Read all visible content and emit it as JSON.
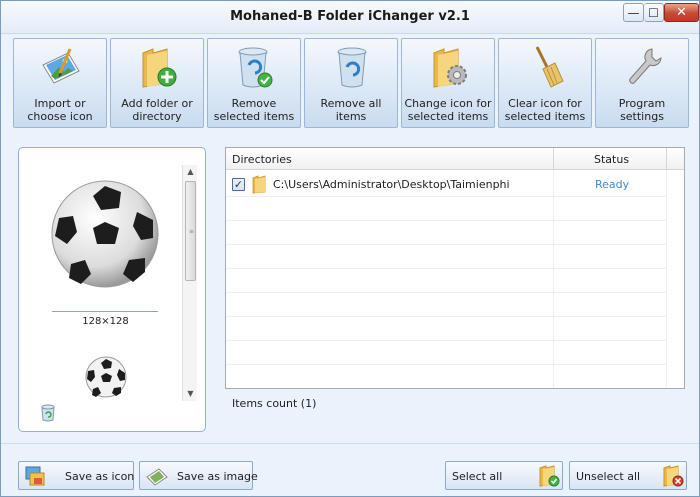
{
  "window": {
    "title": "Mohaned-B Folder iChanger v2.1",
    "minimize_glyph": "—",
    "maximize_glyph": "☐",
    "close_glyph": "✕"
  },
  "toolbar": {
    "buttons": [
      {
        "label": "Import or\nchoose icon",
        "icon": "import-image-icon"
      },
      {
        "label": "Add folder or\ndirectory",
        "icon": "add-folder-icon"
      },
      {
        "label": "Remove\nselected items",
        "icon": "recycle-bin-check-icon"
      },
      {
        "label": "Remove all items",
        "icon": "recycle-bin-icon"
      },
      {
        "label": "Change icon for\nselected items",
        "icon": "folder-gear-icon"
      },
      {
        "label": "Clear icon for\nselected items",
        "icon": "broom-icon"
      },
      {
        "label": "Program\nsettings",
        "icon": "wrench-icon"
      }
    ]
  },
  "preview": {
    "size_label": "128×128"
  },
  "list": {
    "columns": {
      "directories": "Directories",
      "status": "Status"
    },
    "rows": [
      {
        "checked": true,
        "checkbox_glyph": "✓",
        "path": "C:\\Users\\Administrator\\Desktop\\Taimienphi",
        "status": "Ready"
      }
    ],
    "items_count": "Items count (1)"
  },
  "bottom": {
    "save_icon": "Save as icon",
    "save_image": "Save as image",
    "select_all": "Select all",
    "unselect_all": "Unselect all"
  },
  "colors": {
    "status_ready": "#3a8ed0",
    "close_button": "#c0392b",
    "panel_border": "#8fb3de"
  }
}
